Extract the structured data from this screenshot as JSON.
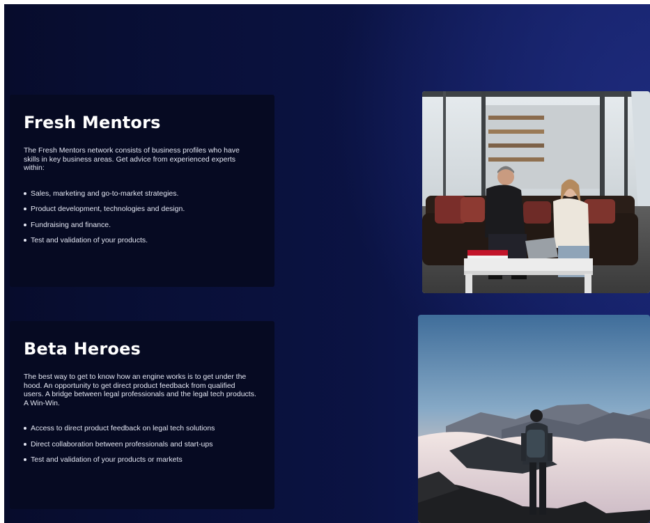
{
  "sections": [
    {
      "title": "Fresh Mentors",
      "description": "The Fresh Mentors network consists of business profiles who have skills in key business areas. Get advice from experienced experts within:",
      "bullets": [
        "Sales, marketing and go-to-market strategies.",
        "Product development, technologies and design.",
        "Fundraising and finance.",
        "Test and validation of your products."
      ],
      "image": "office-meeting-photo"
    },
    {
      "title": "Beta Heroes",
      "description": "The best way to get to know how an engine works is to get under the hood. An opportunity to get direct product feedback from qualified users. A bridge between legal professionals and the legal tech products. A Win-Win.",
      "bullets": [
        "Access to direct product feedback on legal tech solutions",
        "Direct collaboration between professionals and start-ups",
        "Test and validation of your products or markets"
      ],
      "image": "mountain-hiker-photo"
    }
  ],
  "colors": {
    "background_dark": "#070c2c",
    "background_glow": "#1d2a7a",
    "panel": "#060a22",
    "text": "#e4e7f3"
  }
}
